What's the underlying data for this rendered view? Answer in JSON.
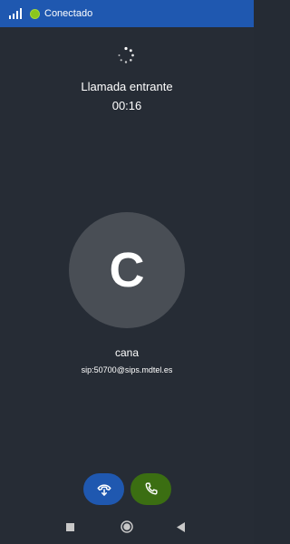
{
  "status_bar": {
    "connection_status": "Conectado",
    "status_color": "#8bc61c",
    "signal_icon": "signal-bars-icon"
  },
  "call": {
    "state": "Llamada entrante",
    "timer": "00:16",
    "loading_icon": "spinner-icon"
  },
  "caller": {
    "avatar_letter": "C",
    "name": "cana",
    "uri": "sip:50700@sips.mdtel.es"
  },
  "actions": {
    "deflect_icon": "phone-forward-icon",
    "deflect_color": "#1f58b0",
    "answer_icon": "phone-icon",
    "answer_color": "#3b6e12"
  },
  "navigation": {
    "back_icon": "square-icon",
    "home_icon": "circle-icon",
    "recents_icon": "triangle-left-icon"
  },
  "colors": {
    "background": "#262c35",
    "status_bar": "#1f58b0",
    "avatar": "#494e55"
  }
}
